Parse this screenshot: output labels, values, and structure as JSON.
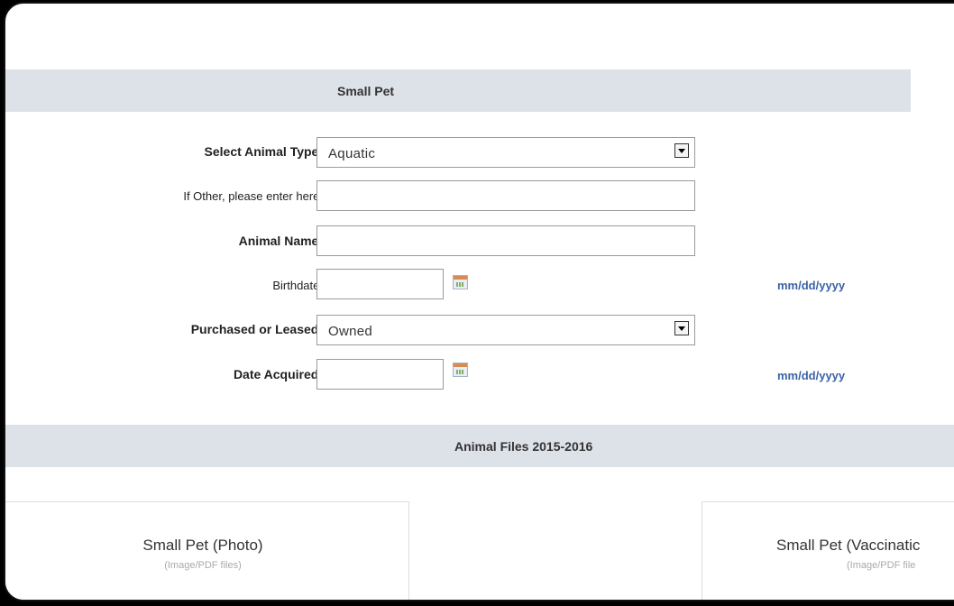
{
  "section_small_pet": {
    "title": "Small Pet"
  },
  "form": {
    "animal_type": {
      "label": "Select Animal Type:",
      "value": "Aquatic"
    },
    "other": {
      "label": "If Other, please enter here:",
      "value": ""
    },
    "animal_name": {
      "label": "Animal Name:",
      "value": ""
    },
    "birthdate": {
      "label": "Birthdate:",
      "value": "",
      "hint": "mm/dd/yyyy"
    },
    "purchased_leased": {
      "label": "Purchased or Leased:",
      "value": "Owned"
    },
    "date_acquired": {
      "label": "Date Acquired:",
      "value": "",
      "hint": "mm/dd/yyyy"
    }
  },
  "section_files": {
    "title": "Animal Files 2015-2016"
  },
  "files": [
    {
      "title": "Small Pet (Photo)",
      "subtitle": "(Image/PDF files)"
    },
    {
      "title": "Small Pet (Vaccinatic",
      "subtitle": "(Image/PDF file"
    }
  ],
  "icons": [
    "calendar-icon",
    "dropdown-arrow-icon"
  ]
}
